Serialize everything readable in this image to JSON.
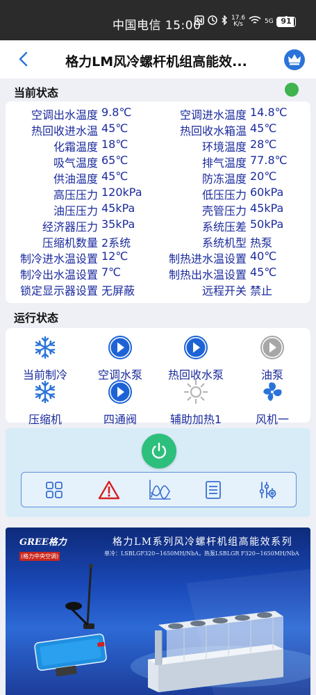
{
  "status_bar": {
    "carrier_time": "中国电信 15:00",
    "speed_top": "17.6",
    "speed_unit": "K/s",
    "network": "5G",
    "battery": "91",
    "battery_level": 0.91
  },
  "header": {
    "title": "格力LM风冷螺杆机组高能效..."
  },
  "current_status": {
    "title": "当前状态",
    "indicator_color": "#3fb34f",
    "rows": [
      {
        "l1": "空调出水温度",
        "v1": "9.8℃",
        "l2": "空调进水温度",
        "v2": "14.8℃"
      },
      {
        "l1": "热回收进水温",
        "v1": "45℃",
        "l2": "热回收水箱温",
        "v2": "45℃"
      },
      {
        "l1": "化霜温度",
        "v1": "18℃",
        "l2": "环境温度",
        "v2": "28℃"
      },
      {
        "l1": "吸气温度",
        "v1": "65℃",
        "l2": "排气温度",
        "v2": "77.8℃"
      },
      {
        "l1": "供油温度",
        "v1": "45℃",
        "l2": "防冻温度",
        "v2": "20℃"
      },
      {
        "l1": "高压压力",
        "v1": "120kPa",
        "l2": "低压压力",
        "v2": "60kPa"
      },
      {
        "l1": "油压压力",
        "v1": "45kPa",
        "l2": "壳管压力",
        "v2": "45kPa"
      },
      {
        "l1": "经济器压力",
        "v1": "35kPa",
        "l2": "系统压差",
        "v2": "50kPa"
      },
      {
        "l1": "压缩机数量",
        "v1": "2系统",
        "l2": "系统机型",
        "v2": "热泵"
      },
      {
        "l1": "制冷进水温设置",
        "v1": "12℃",
        "l2": "制热进水温设置",
        "v2": "40℃"
      },
      {
        "l1": "制冷出水温设置",
        "v1": "7℃",
        "l2": "制热出水温设置",
        "v2": "45℃"
      },
      {
        "l1": "锁定显示器设置",
        "v1": "无屏蔽",
        "l2": "远程开关",
        "v2": "禁止"
      }
    ]
  },
  "run_status": {
    "title": "运行状态",
    "items": [
      {
        "label": "当前制冷",
        "icon": "snowflake-icon",
        "color": "#2a73d8"
      },
      {
        "label": "空调水泵",
        "icon": "play-circle-icon",
        "color": "#1d63d6"
      },
      {
        "label": "热回收水泵",
        "icon": "play-circle-icon",
        "color": "#1d63d6"
      },
      {
        "label": "油泵",
        "icon": "play-circle-icon",
        "color": "#a7a7a7"
      },
      {
        "label": "压缩机",
        "icon": "snowflake-icon",
        "color": "#2a73d8"
      },
      {
        "label": "四通阀",
        "icon": "play-circle-icon",
        "color": "#1d63d6"
      },
      {
        "label": "辅助加热1",
        "icon": "sun-icon",
        "color": "#b5b5b5"
      },
      {
        "label": "风机一",
        "icon": "fan-icon",
        "color": "#2a73d8"
      }
    ]
  },
  "controls": {
    "power_color": "#2dbf7c",
    "tools": [
      "grid-icon",
      "alert-icon",
      "chart-icon",
      "list-icon",
      "settings-sliders-icon"
    ]
  },
  "banner": {
    "logo_text": "GREE格力",
    "logo_sub": "(格力中央空调)",
    "title": "格力LM系列风冷螺杆机组高能效系列",
    "subtitle": "单冷：LSBLGF320~1650MH/NbA，热泵LSBLGR F320~1650MH/NbA"
  }
}
